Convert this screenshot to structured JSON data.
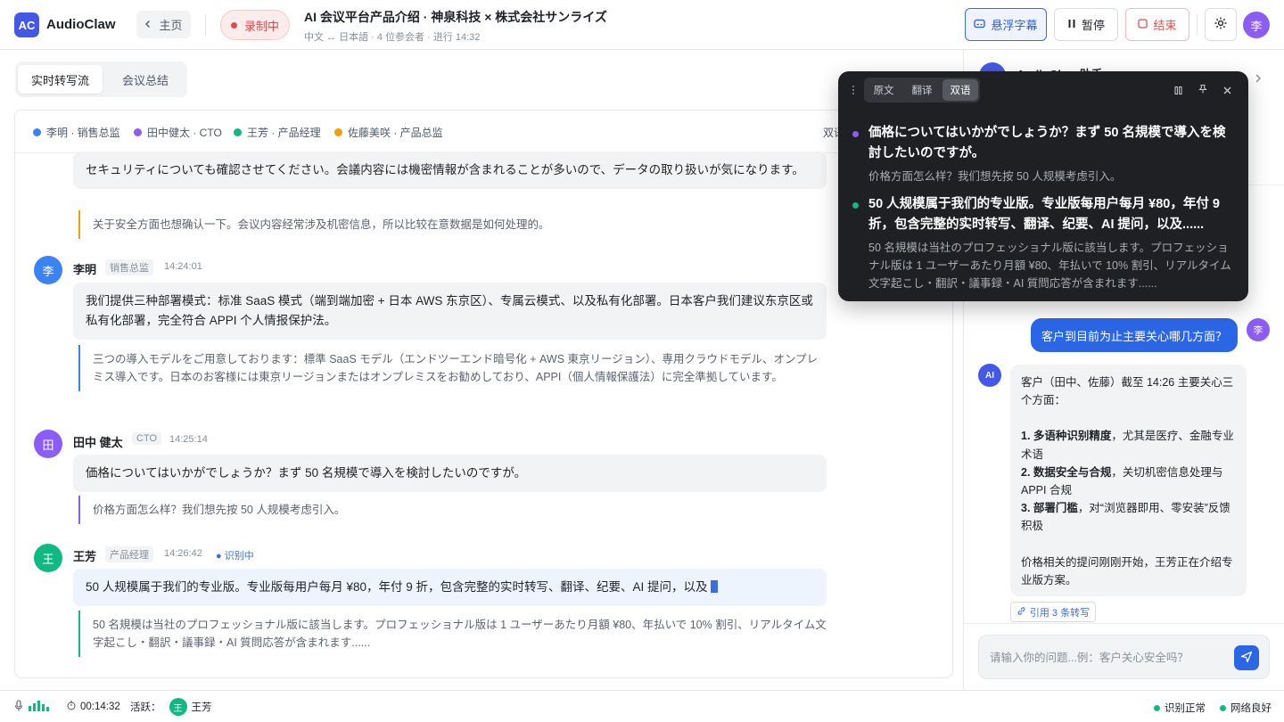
{
  "app": {
    "name": "AudioClaw",
    "logo_text": "AC"
  },
  "topbar": {
    "home_label": "主页",
    "recording_label": "录制中",
    "meeting_title": "AI 会议平台产品介绍 · 神泉科技 × 株式会社サンライズ",
    "meeting_sub": "中文 ↔ 日本語 · 4 位参会者 · 进行 14:32",
    "float_subtitle_label": "悬浮字幕",
    "pause_label": "暂停",
    "end_label": "结束",
    "user_avatar": "李"
  },
  "tabs": [
    {
      "label": "实时转写流"
    },
    {
      "label": "会议总结"
    }
  ],
  "legend": [
    {
      "name": "李明 · 销售总监",
      "color": "#3b82f6"
    },
    {
      "name": "田中健太 · CTO",
      "color": "#8b5cf6"
    },
    {
      "name": "王芳 · 产品经理",
      "color": "#10b981"
    },
    {
      "name": "佐藤美咲 · 产品总监",
      "color": "#f59e0b"
    }
  ],
  "legend_mode": "双语",
  "messages": [
    {
      "text": "セキュリティについても確認させてください。会議内容には機密情報が含まれることが多いので、データの取り扱いが気になります。",
      "translation": "关于安全方面也想确认一下。会议内容经常涉及机密信息，所以比较在意数据是如何处理的。",
      "color": "#f59e0b"
    },
    {
      "avatar": "李",
      "name": "李明",
      "role": "销售总监",
      "time": "14:24:01",
      "color": "#3b82f6",
      "text": "我们提供三种部署模式：标准 SaaS 模式（端到端加密 + 日本 AWS 东京区）、专属云模式、以及私有化部署。日本客户我们建议东京区或私有化部署，完全符合 APPI 个人情报保护法。",
      "translation": "三つの導入モデルをご用意しております：標準 SaaS モデル（エンドツーエンド暗号化 + AWS 東京リージョン）、専用クラウドモデル、オンプレミス導入です。日本のお客様には東京リージョンまたはオンプレミスをお勧めしており、APPI（個人情報保護法）に完全準拠しています。"
    },
    {
      "avatar": "田",
      "name": "田中 健太",
      "role": "CTO",
      "time": "14:25:14",
      "color": "#8b5cf6",
      "text": "価格についてはいかがでしょうか？まず 50 名規模で導入を検討したいのですが。",
      "translation": "价格方面怎么样？我们想先按 50 人规模考虑引入。"
    },
    {
      "avatar": "王",
      "name": "王芳",
      "role": "产品经理",
      "time": "14:26:42",
      "color": "#10b981",
      "live_label": "识别中",
      "text": "50 人规模属于我们的专业版。专业版每用户每月 ¥80，年付 9 折，包含完整的实时转写、翻译、纪要、AI 提问，以及",
      "translation": "50 名規模は当社のプロフェッショナル版に該当します。プロフェッショナル版は 1 ユーザーあたり月額 ¥80、年払いで 10% 割引、リアルタイム文字起こし・翻訳・議事録・AI 質問応答が含まれます......"
    }
  ],
  "overlay": {
    "tabs": [
      {
        "label": "原文"
      },
      {
        "label": "翻译"
      },
      {
        "label": "双语"
      }
    ],
    "lines": [
      {
        "main": "価格についてはいかがでしょうか？まず 50 名規模で導入を検討したいのですが。",
        "sub": "价格方面怎么样？我们想先按 50 人规模考虑引入。",
        "color": "#8b5cf6"
      },
      {
        "main": "50 人规模属于我们的专业版。专业版每用户每月 ¥80，年付 9 折，包含完整的实时转写、翻译、纪要、AI 提问，以及......",
        "sub": "50 名規模は当社のプロフェッショナル版に該当します。プロフェッショナル版は 1 ユーザーあたり月額 ¥80、年払いで 10% 割引、リアルタイム文字起こし・翻訳・議事録・AI 質問応答が含まれます......",
        "color": "#10b981"
      }
    ]
  },
  "assistant": {
    "title": "AudioClaw 助手",
    "user_avatar": "李",
    "question": "客户到目前为止主要关心哪几方面？",
    "ai_avatar": "AI",
    "answer_intro": "客户（田中、佐藤）截至 14:26 主要关心三个方面：",
    "points": [
      {
        "title": "1. 多语种识别精度",
        "rest": "，尤其是医疗、金融专业术语"
      },
      {
        "title": "2. 数据安全与合规",
        "rest": "，关切机密信息处理与 APPI 合规"
      },
      {
        "title": "3. 部署门槛",
        "rest": "，对“浏览器即用、零安装”反馈积极"
      }
    ],
    "answer_outro": "价格相关的提问刚刚开始，王芳正在介绍专业版方案。",
    "cite_label": "引用 3 条转写",
    "input_placeholder": "请输入你的问题...例：客户关心安全吗？"
  },
  "status": {
    "timer": "00:14:32",
    "active_label": "活跃：",
    "active_avatar": "王",
    "active_name": "王芳",
    "recognition": "识别正常",
    "network": "网络良好"
  }
}
